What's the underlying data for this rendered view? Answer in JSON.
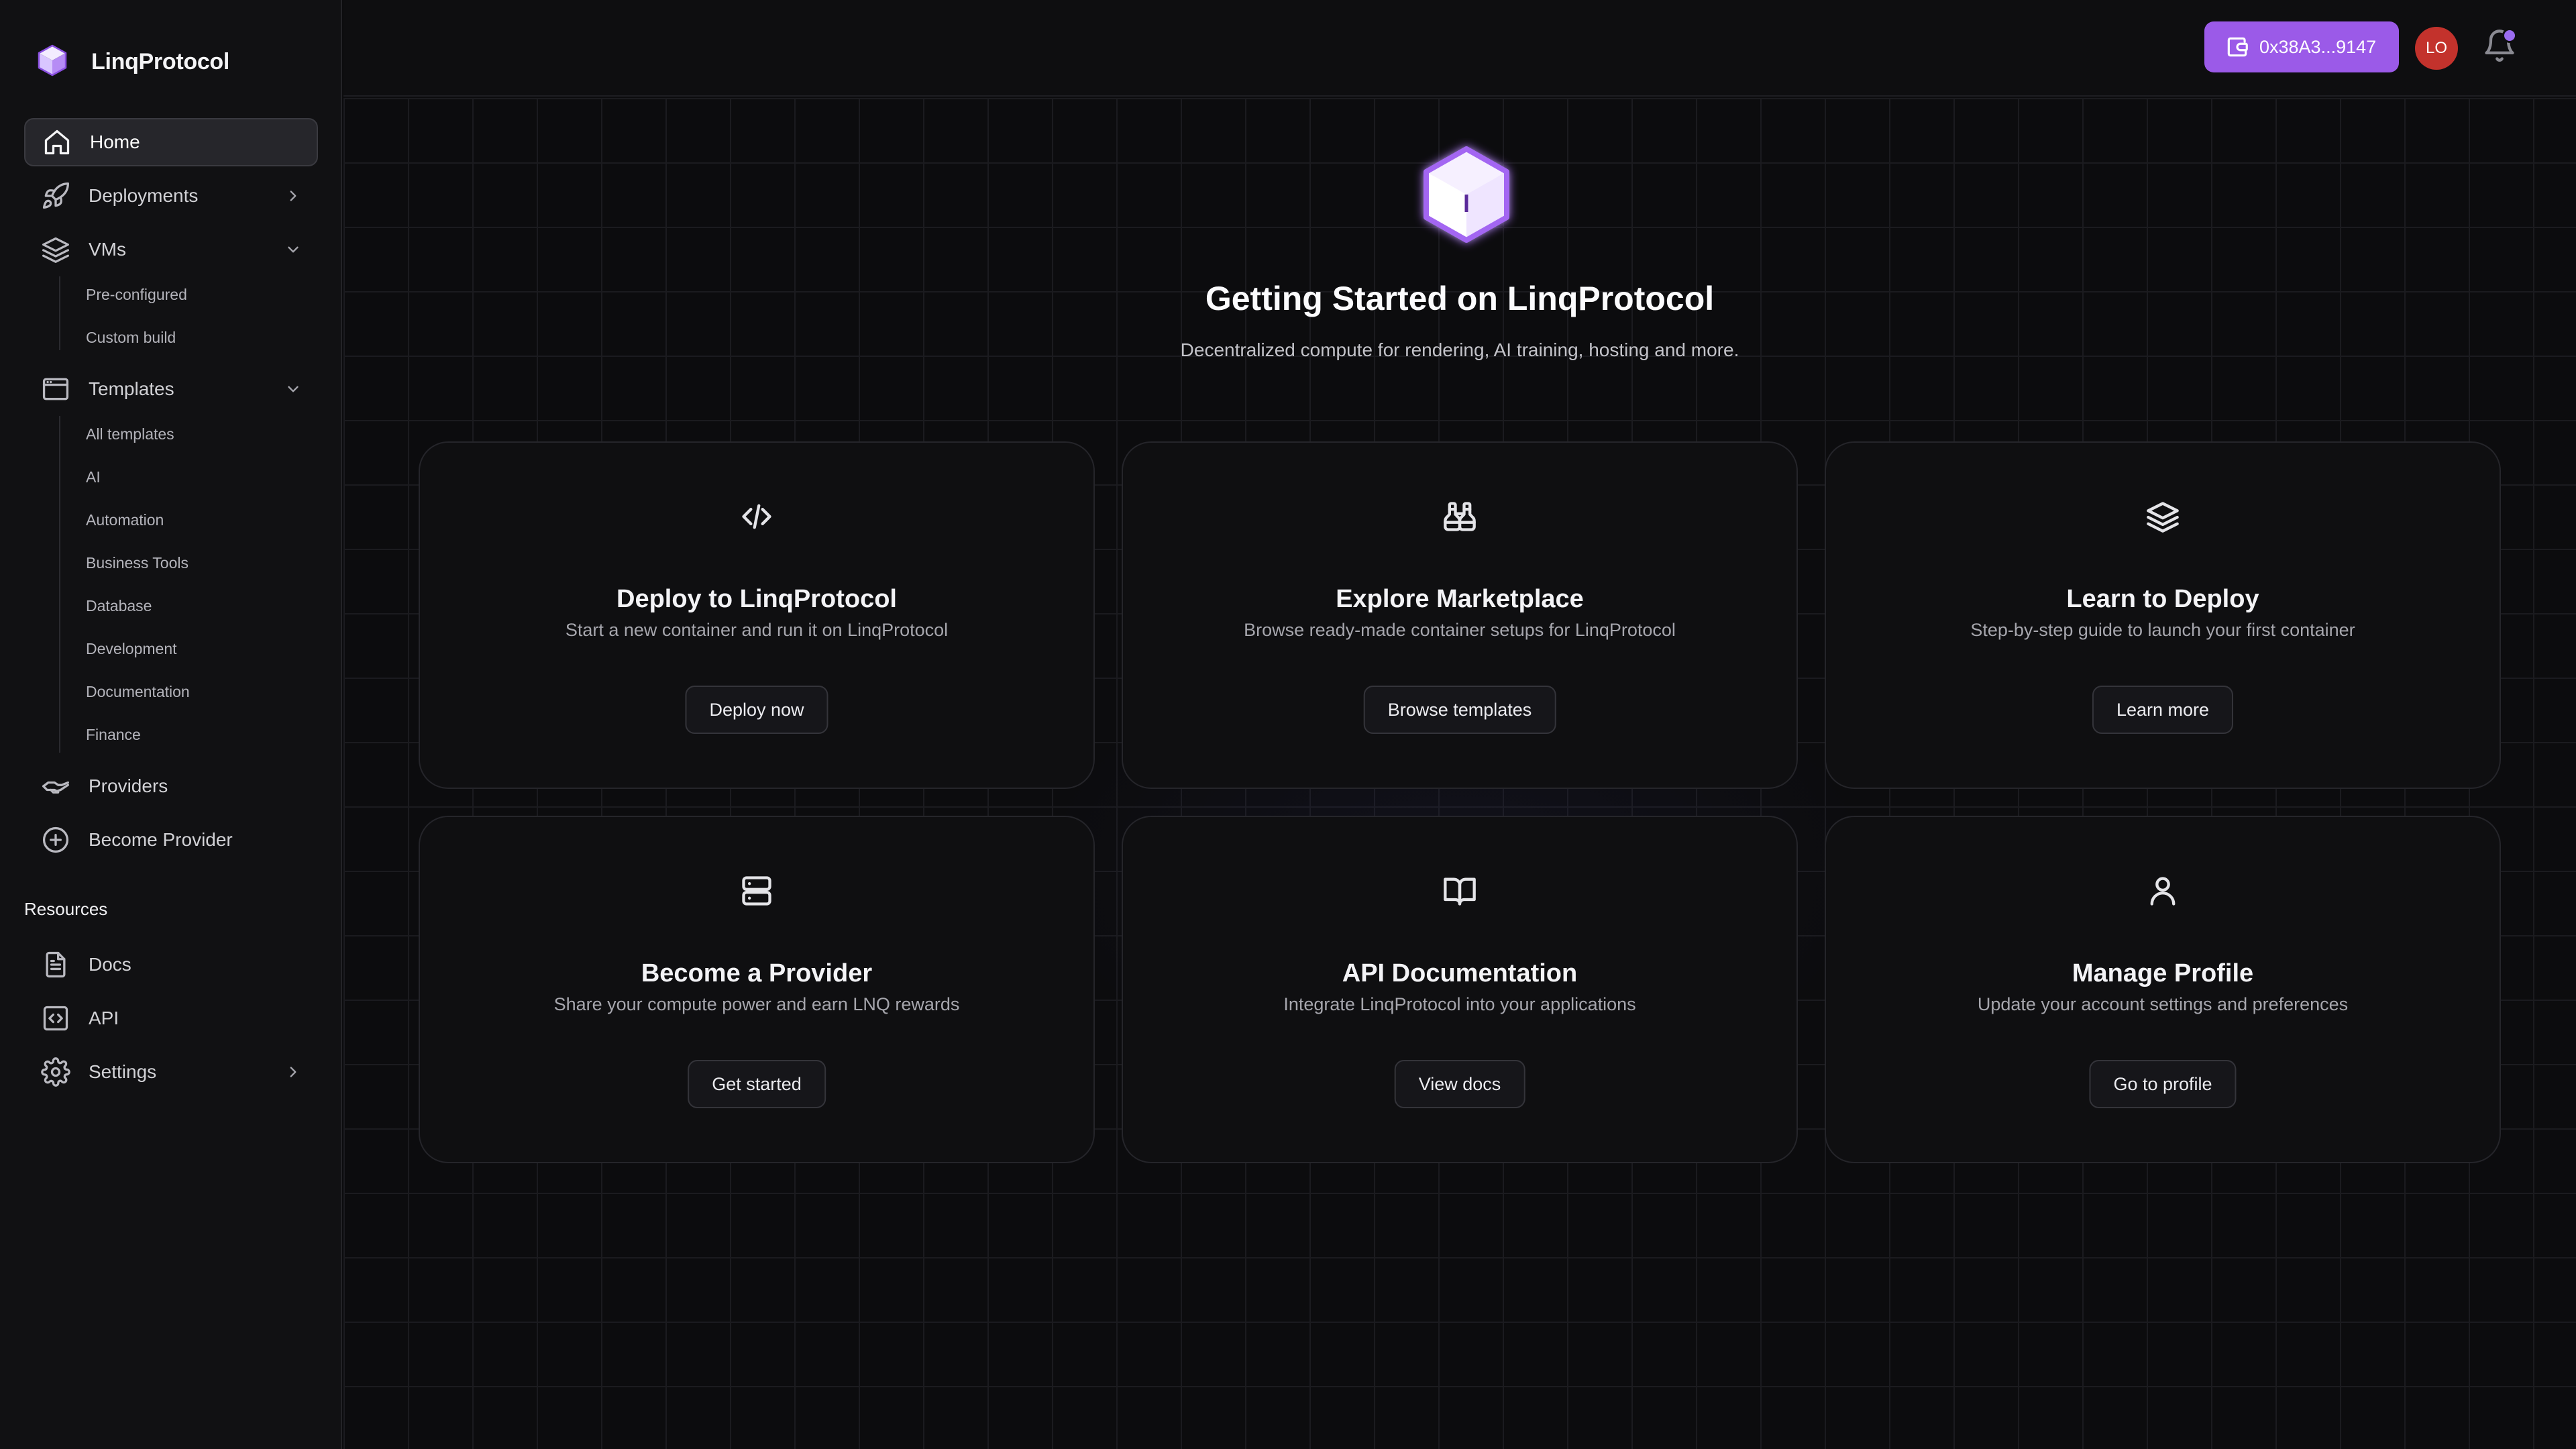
{
  "brand": {
    "name": "LinqProtocol",
    "accent": "#9b5ae8"
  },
  "sidebar": {
    "home": "Home",
    "deployments": "Deployments",
    "vms": "VMs",
    "vms_children": [
      "Pre-configured",
      "Custom build"
    ],
    "templates": "Templates",
    "templates_children": [
      "All templates",
      "AI",
      "Automation",
      "Business Tools",
      "Database",
      "Development",
      "Documentation",
      "Finance"
    ],
    "providers": "Providers",
    "become_provider": "Become Provider",
    "resources_title": "Resources",
    "docs": "Docs",
    "api": "API",
    "settings": "Settings"
  },
  "header": {
    "wallet": "0x38A3...9147",
    "avatar": "LO",
    "notification_color": "#9b6cf0",
    "avatar_color": "#c3322c"
  },
  "hero": {
    "title": "Getting Started on LinqProtocol",
    "subtitle": "Decentralized compute for rendering, AI training, hosting and more."
  },
  "cards": [
    {
      "icon": "code-icon",
      "title": "Deploy to LinqProtocol",
      "desc": "Start a new container and run it on LinqProtocol",
      "button": "Deploy now"
    },
    {
      "icon": "binoculars-icon",
      "title": "Explore Marketplace",
      "desc": "Browse ready-made container setups for LinqProtocol",
      "button": "Browse templates"
    },
    {
      "icon": "layers-icon",
      "title": "Learn to Deploy",
      "desc": "Step-by-step guide to launch your first container",
      "button": "Learn more"
    },
    {
      "icon": "server-icon",
      "title": "Become a Provider",
      "desc": "Share your compute power and earn LNQ rewards",
      "button": "Get started"
    },
    {
      "icon": "book-open-icon",
      "title": "API Documentation",
      "desc": "Integrate LinqProtocol into your applications",
      "button": "View docs"
    },
    {
      "icon": "user-icon",
      "title": "Manage Profile",
      "desc": "Update your account settings and preferences",
      "button": "Go to profile"
    }
  ]
}
